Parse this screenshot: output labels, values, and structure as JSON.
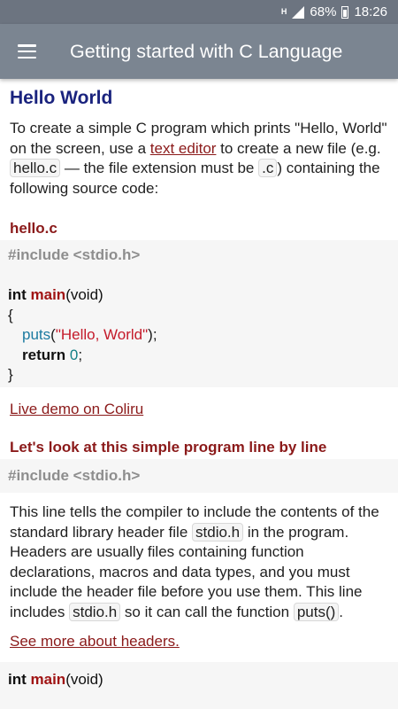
{
  "status_bar": {
    "network": "H",
    "battery": "68%",
    "time": "18:26"
  },
  "app_bar": {
    "title": "Getting started with C Language"
  },
  "section": {
    "title": "Hello World"
  },
  "intro": {
    "t1": "To create a simple C program which prints \"Hello, World\" on the screen, use a ",
    "link": "text editor",
    "t2": " to create a new file (e.g. ",
    "code1": "hello.c",
    "t3": " — the file extension must be ",
    "code2": ".c",
    "t4": ") containing the following source code:"
  },
  "file_label": "hello.c",
  "code": {
    "include": "#include <stdio.h>",
    "int": "int ",
    "main": "main",
    "void": "(void)",
    "brace_open": "{",
    "puts": "puts",
    "paren_open": "(",
    "string": "\"Hello, World\"",
    "paren_close": ");",
    "return": "return ",
    "zero": "0",
    "semi": ";",
    "brace_close": "}"
  },
  "demo_link": "Live demo on Coliru",
  "line_by_line": {
    "title": "Let's look at this simple program line by line"
  },
  "include_block": "#include <stdio.h>",
  "explain": {
    "t1": "This line tells the compiler to include the contents of the standard library header file ",
    "code1": "stdio.h",
    "t2": " in the program. Headers are usually files containing function declarations, macros and data types, and you must include the header file before you use them. This line includes ",
    "code2": "stdio.h",
    "t3": " so it can call the function ",
    "code3": "puts()",
    "t4": "."
  },
  "headers_link": "See more about headers.",
  "main_block": {
    "int": "int ",
    "main": "main",
    "void": "(void)"
  }
}
